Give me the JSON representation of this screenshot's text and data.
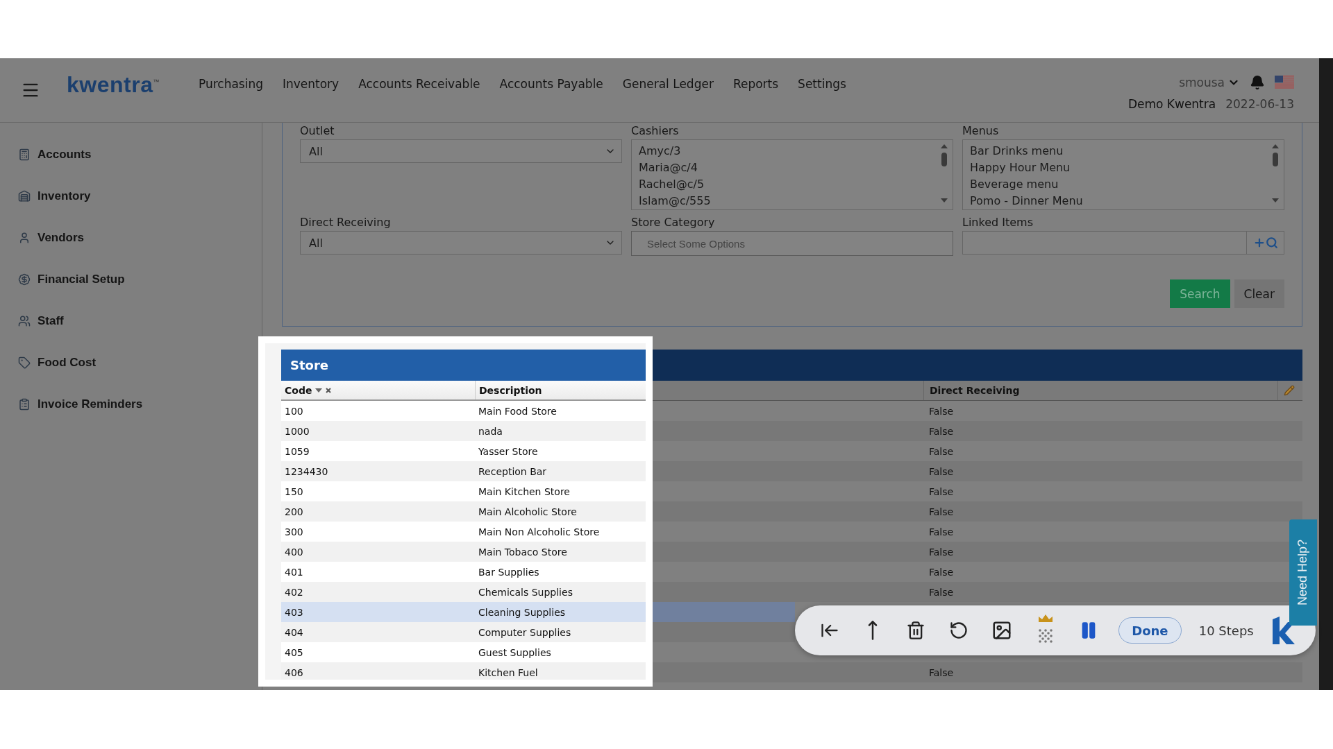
{
  "logo": "kwentra$^{™}$",
  "nav": [
    "Purchasing",
    "Inventory",
    "Accounts Receivable",
    "Accounts Payable",
    "General Ledger",
    "Reports",
    "Settings"
  ],
  "user": {
    "name": "smousa",
    "company": "Demo Kwentra",
    "date": "2022-06-13"
  },
  "sidebar": [
    {
      "label": "Accounts"
    },
    {
      "label": "Inventory"
    },
    {
      "label": "Vendors"
    },
    {
      "label": "Financial Setup"
    },
    {
      "label": "Staff"
    },
    {
      "label": "Food Cost"
    },
    {
      "label": "Invoice Reminders"
    }
  ],
  "filters": [
    {
      "label": "Outlet",
      "kind": "select",
      "value": "All"
    },
    {
      "label": "Cashiers",
      "kind": "listbox",
      "options": [
        "Amyc/3",
        "Maria@c/4",
        "Rachel@c/5",
        "Islam@c/555"
      ]
    },
    {
      "label": "Menus",
      "kind": "listbox",
      "options": [
        "Bar Drinks menu",
        "Happy Hour Menu",
        "Beverage menu",
        "Pomo - Dinner Menu"
      ]
    },
    {
      "label": "Direct Receiving",
      "kind": "select",
      "value": "All"
    },
    {
      "label": "Store Category",
      "kind": "multiselect",
      "placeholder": "Select Some Options"
    },
    {
      "label": "Linked Items",
      "kind": "search"
    }
  ],
  "actions": [
    {
      "label": "Search",
      "kind": "primary"
    },
    {
      "label": "Clear",
      "kind": "plain"
    }
  ],
  "results_table": {
    "columns": [
      "Direct Receiving"
    ],
    "rows": [
      {
        "direct_receiving": "False",
        "selected": false
      },
      {
        "direct_receiving": "False",
        "selected": false
      },
      {
        "direct_receiving": "False",
        "selected": false
      },
      {
        "direct_receiving": "False",
        "selected": false
      },
      {
        "direct_receiving": "False",
        "selected": false
      },
      {
        "direct_receiving": "False",
        "selected": false
      },
      {
        "direct_receiving": "False",
        "selected": false
      },
      {
        "direct_receiving": "False",
        "selected": false
      },
      {
        "direct_receiving": "False",
        "selected": false
      },
      {
        "direct_receiving": "False",
        "selected": false
      },
      {
        "selected": true
      },
      {
        "selected": false
      },
      {
        "selected": false
      },
      {
        "direct_receiving": "False",
        "selected": false
      }
    ]
  },
  "store_popup": {
    "title": "Store",
    "columns": [
      "Code",
      "Description"
    ],
    "rows": [
      {
        "code": "100",
        "description": "Main Food Store",
        "selected": false
      },
      {
        "code": "1000",
        "description": "nada",
        "selected": false
      },
      {
        "code": "1059",
        "description": "Yasser Store",
        "selected": false
      },
      {
        "code": "1234430",
        "description": "Reception Bar",
        "selected": false
      },
      {
        "code": "150",
        "description": "Main Kitchen Store",
        "selected": false
      },
      {
        "code": "200",
        "description": "Main Alcoholic Store",
        "selected": false
      },
      {
        "code": "300",
        "description": "Main Non Alcoholic Store",
        "selected": false
      },
      {
        "code": "400",
        "description": "Main Tobaco Store",
        "selected": false
      },
      {
        "code": "401",
        "description": "Bar Supplies",
        "selected": false
      },
      {
        "code": "402",
        "description": "Chemicals Supplies",
        "selected": false
      },
      {
        "code": "403",
        "description": "Cleaning Supplies",
        "selected": true
      },
      {
        "code": "404",
        "description": "Computer Supplies",
        "selected": false
      },
      {
        "code": "405",
        "description": "Guest Supplies",
        "selected": false
      },
      {
        "code": "406",
        "description": "Kitchen Fuel",
        "selected": false
      }
    ]
  },
  "recorder_toolbar": {
    "done": "Done",
    "steps": "10 Steps"
  },
  "help_tab": "Need Help?"
}
